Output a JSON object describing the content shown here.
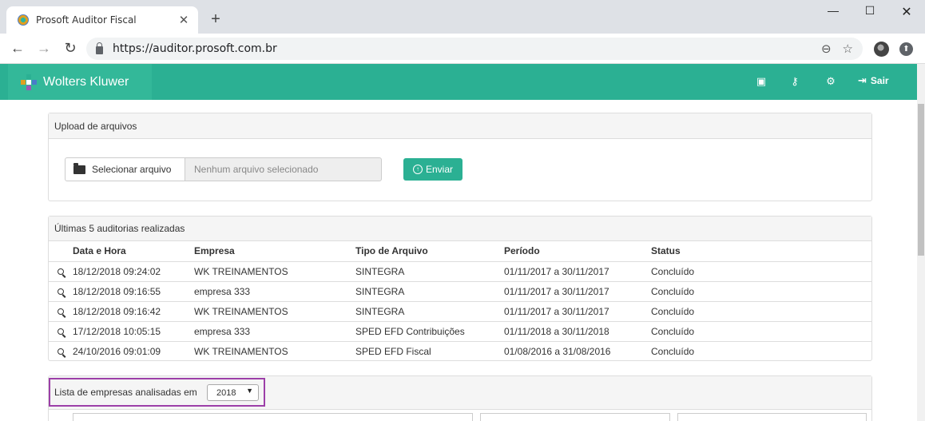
{
  "browser": {
    "tab_title": "Prosoft Auditor Fiscal",
    "tab_close": "✕",
    "new_tab": "+",
    "url": "https://auditor.prosoft.com.br",
    "win_min": "—",
    "win_max": "☐",
    "win_close": "✕"
  },
  "app": {
    "brand": "Wolters Kluwer",
    "brand_colors": [
      "#2bb093",
      "#e0a020",
      "#4a7cc9",
      "#9b59b6"
    ],
    "header_icons": [
      "help-icon",
      "key-icon",
      "gear-icon"
    ],
    "logout_label": "Sair"
  },
  "upload": {
    "heading": "Upload de arquivos",
    "select_label": "Selecionar arquivo",
    "file_placeholder": "Nenhum arquivo selecionado",
    "send_label": "Enviar"
  },
  "audits": {
    "heading": "Últimas 5 auditorias realizadas",
    "columns": [
      "Data e Hora",
      "Empresa",
      "Tipo de Arquivo",
      "Período",
      "Status"
    ],
    "rows": [
      [
        "18/12/2018 09:24:02",
        "WK TREINAMENTOS",
        "SINTEGRA",
        "01/11/2017 a 30/11/2017",
        "Concluído"
      ],
      [
        "18/12/2018 09:16:55",
        "empresa 333",
        "SINTEGRA",
        "01/11/2017 a 30/11/2017",
        "Concluído"
      ],
      [
        "18/12/2018 09:16:42",
        "WK TREINAMENTOS",
        "SINTEGRA",
        "01/11/2017 a 30/11/2017",
        "Concluído"
      ],
      [
        "17/12/2018 10:05:15",
        "empresa 333",
        "SPED EFD Contribuições",
        "01/11/2018 a 30/11/2018",
        "Concluído"
      ],
      [
        "24/10/2016 09:01:09",
        "WK TREINAMENTOS",
        "SPED EFD Fiscal",
        "01/08/2016 a 31/08/2016",
        "Concluído"
      ]
    ]
  },
  "companies": {
    "label": "Lista de empresas analisadas em",
    "year_selected": "2018",
    "highlight_color": "#9c3fa8"
  }
}
